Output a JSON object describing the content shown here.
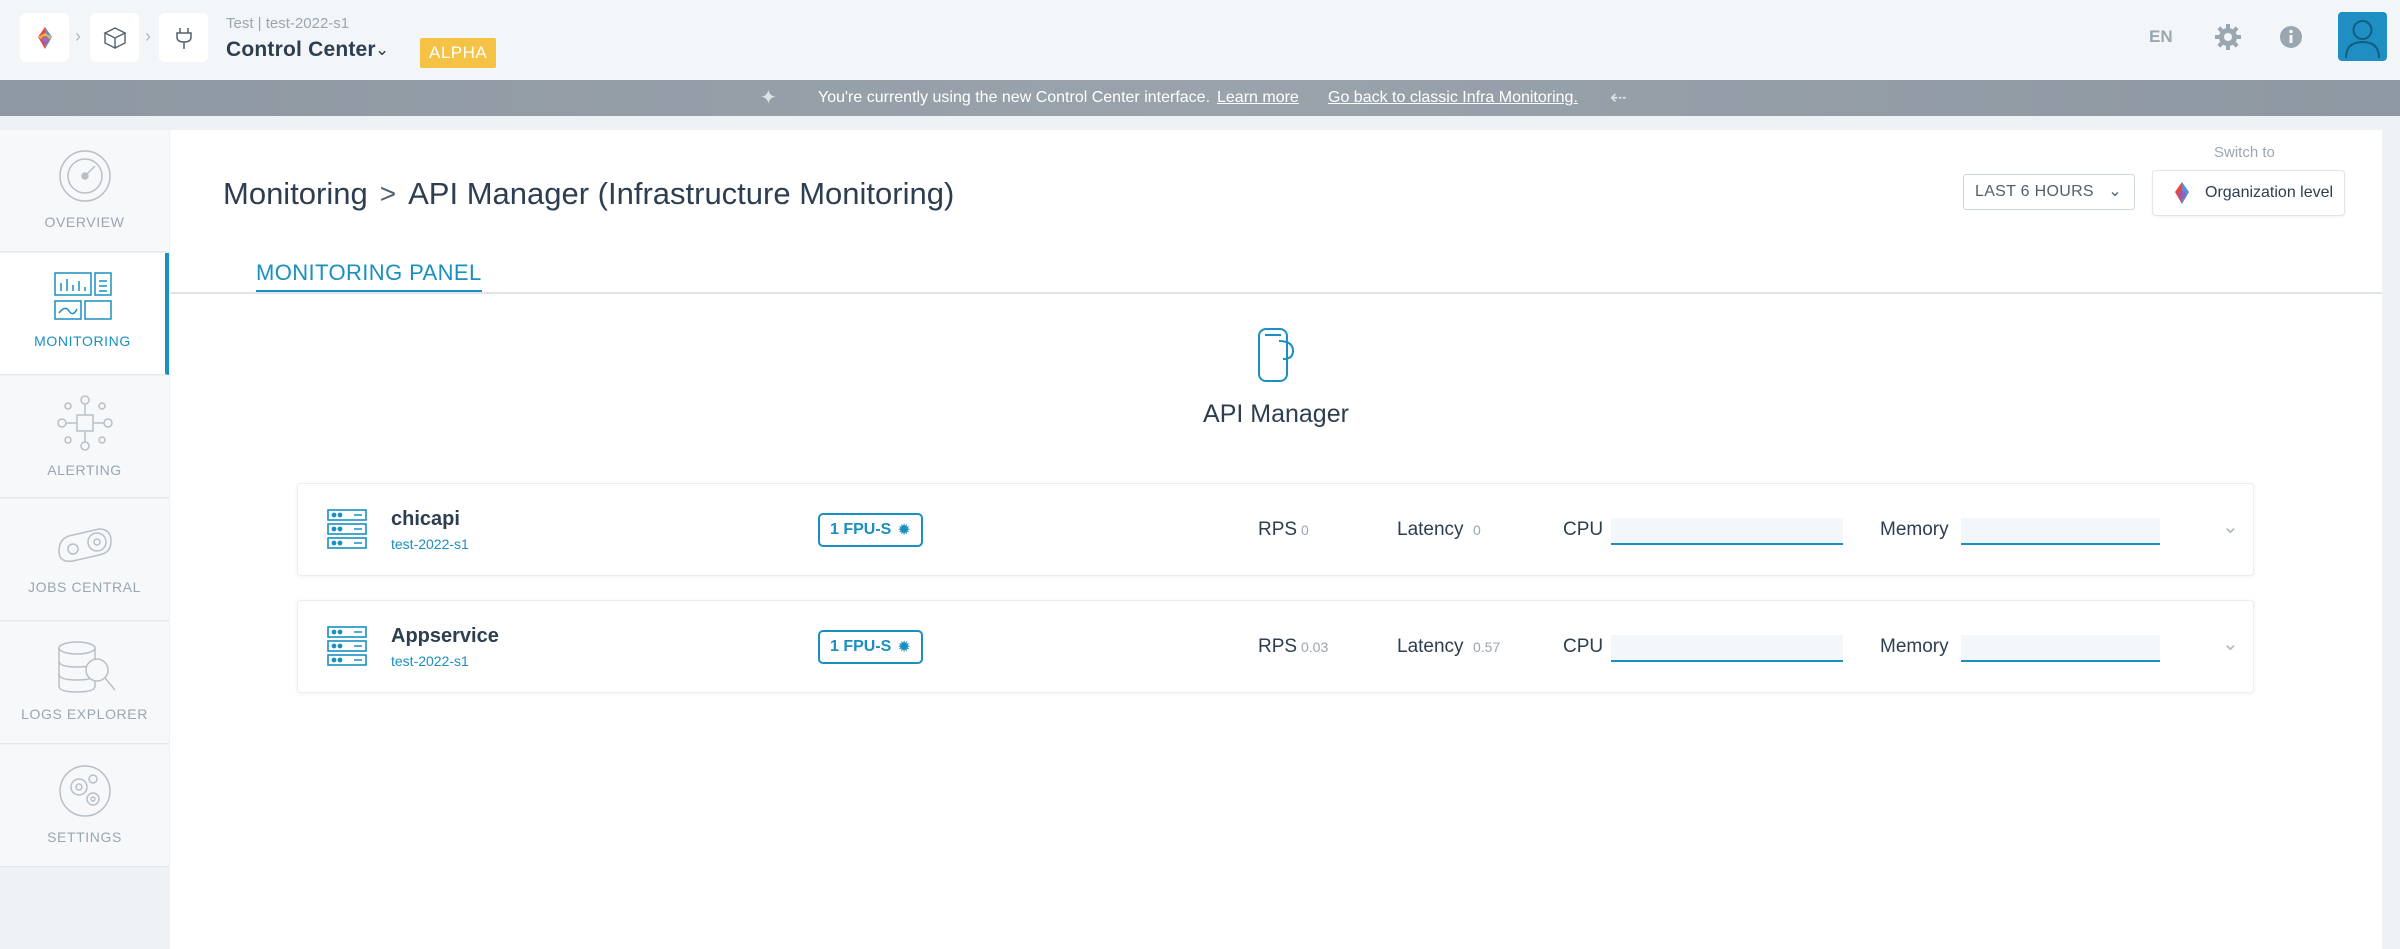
{
  "header": {
    "context": "Test | test-2022-s1",
    "title": "Control Center",
    "badge": "ALPHA",
    "language": "EN"
  },
  "banner": {
    "message": "You're currently using the new Control Center interface.",
    "learn_more": "Learn more",
    "go_back": "Go back to classic Infra Monitoring."
  },
  "sidebar": {
    "items": [
      {
        "label": "OVERVIEW",
        "icon": "gauge-icon",
        "active": false
      },
      {
        "label": "MONITORING",
        "icon": "monitoring-dashboard-icon",
        "active": true
      },
      {
        "label": "ALERTING",
        "icon": "alert-network-icon",
        "active": false
      },
      {
        "label": "JOBS CENTRAL",
        "icon": "jobs-gear-icon",
        "active": false
      },
      {
        "label": "LOGS EXPLORER",
        "icon": "logs-database-icon",
        "active": false
      },
      {
        "label": "SETTINGS",
        "icon": "settings-gears-icon",
        "active": false
      }
    ]
  },
  "main": {
    "breadcrumb_root": "Monitoring",
    "breadcrumb_page": "API Manager (Infrastructure Monitoring)",
    "switch_to": "Switch to",
    "time_range": "LAST 6 HOURS",
    "org_level": "Organization level",
    "tab": "MONITORING PANEL",
    "service_title": "API Manager",
    "services": [
      {
        "name": "chicapi",
        "env": "test-2022-s1",
        "fpu": "1 FPU-S",
        "rps_label": "RPS",
        "rps": "0",
        "latency_label": "Latency",
        "latency": "0",
        "cpu_label": "CPU",
        "memory_label": "Memory"
      },
      {
        "name": "Appservice",
        "env": "test-2022-s1",
        "fpu": "1 FPU-S",
        "rps_label": "RPS",
        "rps": "0.03",
        "latency_label": "Latency",
        "latency": "0.57",
        "cpu_label": "CPU",
        "memory_label": "Memory"
      }
    ]
  },
  "colors": {
    "accent": "#1a8fc1",
    "badge": "#f5c246",
    "banner": "#949ea8"
  }
}
